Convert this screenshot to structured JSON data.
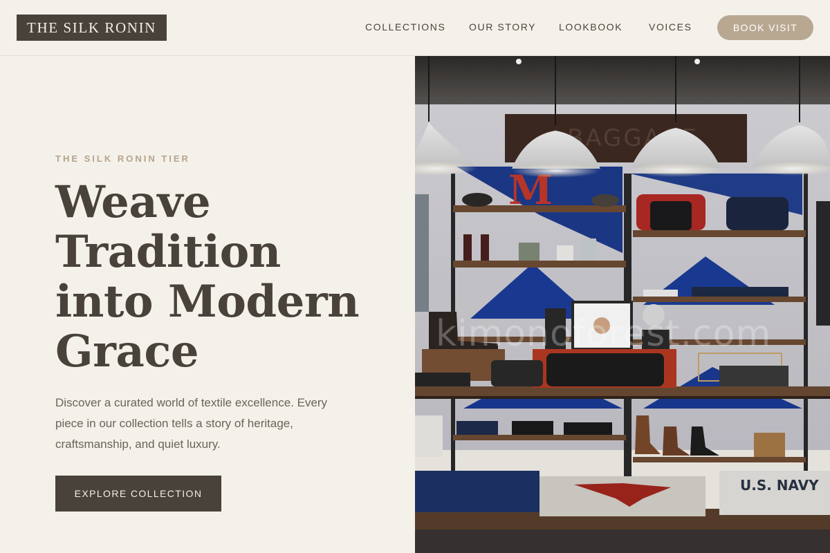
{
  "brand": {
    "logo_text": "THE SILK RONIN"
  },
  "nav": {
    "items": [
      {
        "label": "COLLECTIONS"
      },
      {
        "label": "OUR STORY"
      },
      {
        "label": "LOOKBOOK"
      },
      {
        "label": "VOICES"
      }
    ],
    "cta_label": "BOOK VISIT"
  },
  "hero": {
    "eyebrow": "THE SILK RONIN TIER",
    "title_lines": [
      "Weave",
      "Tradition",
      "into Modern",
      "Grace"
    ],
    "description": "Discover a curated world of textile excellence. Every piece in our collection tells a story of heritage, craftsmanship, and quiet luxury.",
    "cta_label": "EXPLORE COLLECTION"
  },
  "image": {
    "subject": "retail clothing store interior with pendant lamps and shelving",
    "watermark_text": "kimonoforest.com",
    "shop_sign_text": "BAGGAGE",
    "letter_sign_text": "M",
    "navy_shirt_text": "U.S. NAVY"
  },
  "colors": {
    "background": "#f4f1ea",
    "dark_brown": "#48423a",
    "accent_tan": "#b9a891",
    "eyebrow_tan": "#b6a38b"
  }
}
